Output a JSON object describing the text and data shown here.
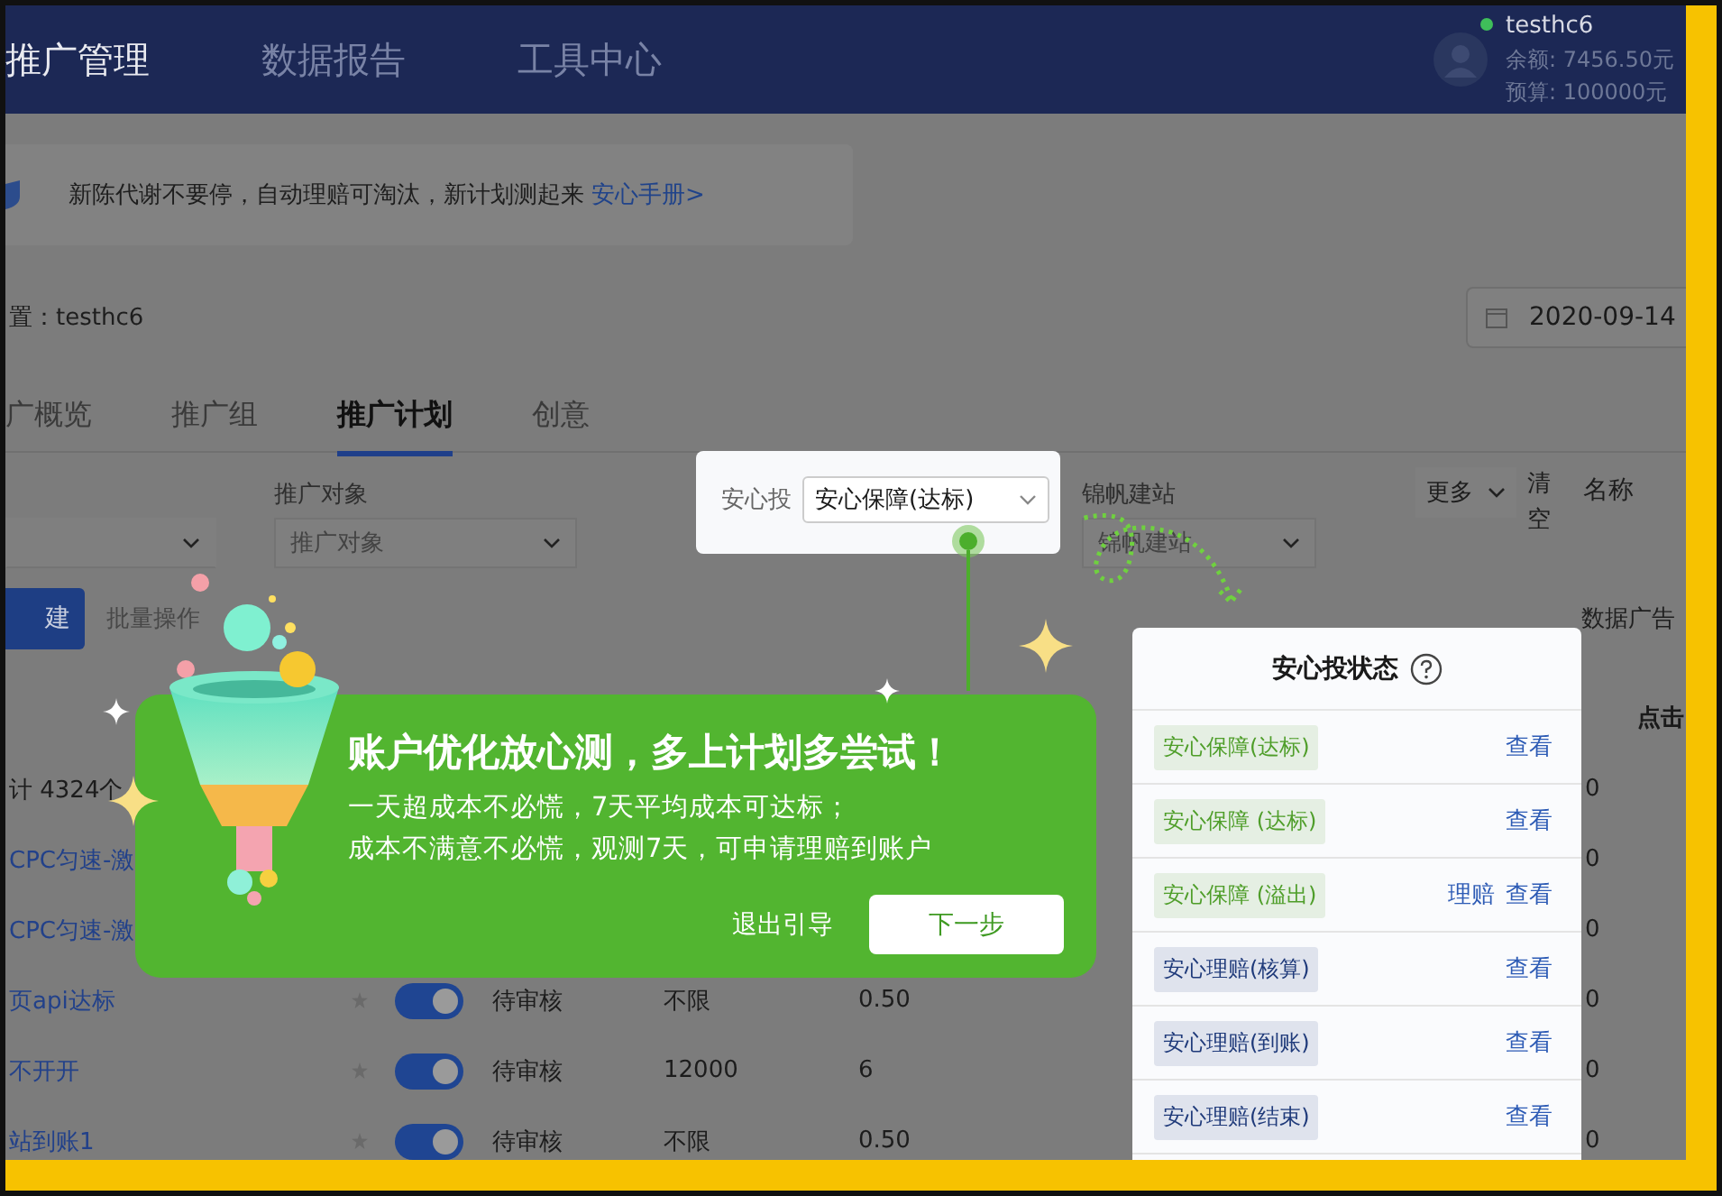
{
  "nav": {
    "items": [
      {
        "label": "推广管理",
        "selected": true
      },
      {
        "label": "数据报告",
        "selected": false
      },
      {
        "label": "工具中心",
        "selected": false
      }
    ],
    "user": {
      "name": "testhc6",
      "online": true,
      "balance": "余额: 7456.50元",
      "budget": "预算: 100000元"
    }
  },
  "notice": {
    "text": "新陈代谢不要停，自动理赔可淘汰，新计划测起来",
    "link": "安心手册>"
  },
  "account": {
    "label": "置：testhc6",
    "date": "2020-09-14"
  },
  "tabs": [
    {
      "label": "广概览",
      "selected": false
    },
    {
      "label": "推广组",
      "selected": false
    },
    {
      "label": "推广计划",
      "selected": true
    },
    {
      "label": "创意",
      "selected": false
    }
  ],
  "filters": [
    {
      "kind": "select"
    },
    {
      "kind": "select",
      "label": "推广对象",
      "placeholder": "推广对象"
    },
    {
      "kind": "select",
      "label": "锦帆建站",
      "placeholder": "锦帆建站"
    },
    {
      "kind": "dropdown",
      "value": "更多"
    },
    {
      "kind": "link",
      "label": "清空"
    },
    {
      "kind": "text",
      "label": "名称"
    }
  ],
  "actions": {
    "new": "建",
    "batch": "批量操作",
    "data_ads": "数据广告"
  },
  "table": {
    "last_column": "点击",
    "summary": {
      "label": "计 4324个",
      "clicks": "0"
    },
    "rows": [
      {
        "name": "CPC匀速-激",
        "clicks": "0"
      },
      {
        "name": "CPC匀速-激",
        "clicks": "0"
      },
      {
        "name": "页api达标",
        "on": true,
        "status": "待审核",
        "budget": "不限",
        "bid": "0.50",
        "clicks": "0"
      },
      {
        "name": "不开开",
        "on": true,
        "status": "待审核",
        "budget": "12000",
        "bid": "6",
        "clicks": "0"
      },
      {
        "name": "站到账1",
        "on": true,
        "status": "待审核",
        "budget": "不限",
        "bid": "0.50",
        "clicks": "0"
      }
    ]
  },
  "guide": {
    "field_label": "安心投",
    "field_value": "安心保障(达标)",
    "title": "账户优化放心测，多上计划多尝试！",
    "lines": [
      "一天超成本不必慌，7天平均成本可达标；",
      "成本不满意不必慌，观测7天，可申请理赔到账户"
    ],
    "exit": "退出引导",
    "next": "下一步"
  },
  "status_panel": {
    "title": "安心投状态",
    "rows": [
      {
        "tag": "安心保障(达标)",
        "color": "#4f9e2a",
        "actions": [
          "查看"
        ]
      },
      {
        "tag": "安心保障 (达标)",
        "color": "#4f9e2a",
        "actions": [
          "查看"
        ]
      },
      {
        "tag": "安心保障 (溢出)",
        "color": "#4f9e2a",
        "actions": [
          "理赔",
          "查看"
        ]
      },
      {
        "tag": "安心理赔(核算)",
        "color": "#1f3a7a",
        "actions": [
          "查看"
        ]
      },
      {
        "tag": "安心理赔(到账)",
        "color": "#1f3a7a",
        "actions": [
          "查看"
        ]
      },
      {
        "tag": "安心理赔(结束)",
        "color": "#1f3a7a",
        "actions": [
          "查看"
        ]
      }
    ]
  }
}
